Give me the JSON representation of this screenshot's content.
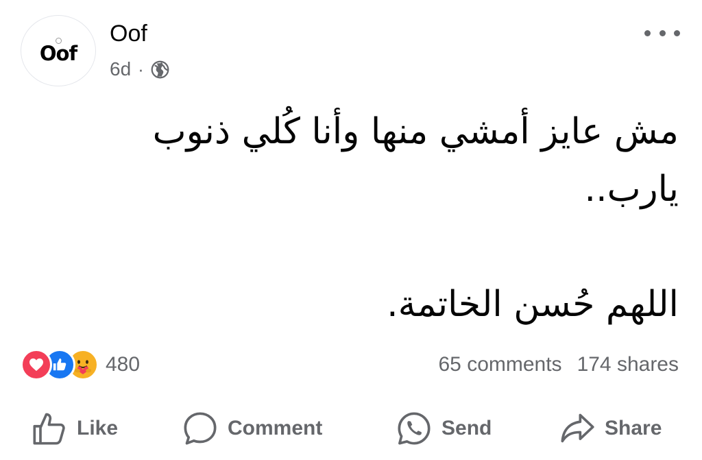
{
  "post": {
    "author": "Oof",
    "avatar_logo": "Oof",
    "time": "6d",
    "separator": "·",
    "privacy_icon": "globe-icon",
    "more_icon": "more-options-icon",
    "text": "مش عايز أمشي منها وأنا كُلي ذنوب\nيارب..\n\nاللهم حُسن الخاتمة."
  },
  "engagement": {
    "reaction_icons": [
      "love-reaction-icon",
      "like-reaction-icon",
      "care-reaction-icon"
    ],
    "reaction_count": "480",
    "comments": "65 comments",
    "shares": "174 shares"
  },
  "actions": {
    "like": "Like",
    "comment": "Comment",
    "send": "Send",
    "share": "Share"
  },
  "colors": {
    "text": "#050505",
    "secondary": "#65676b",
    "love": "#f33e58",
    "like": "#1877f2",
    "care": "#f7b125"
  }
}
